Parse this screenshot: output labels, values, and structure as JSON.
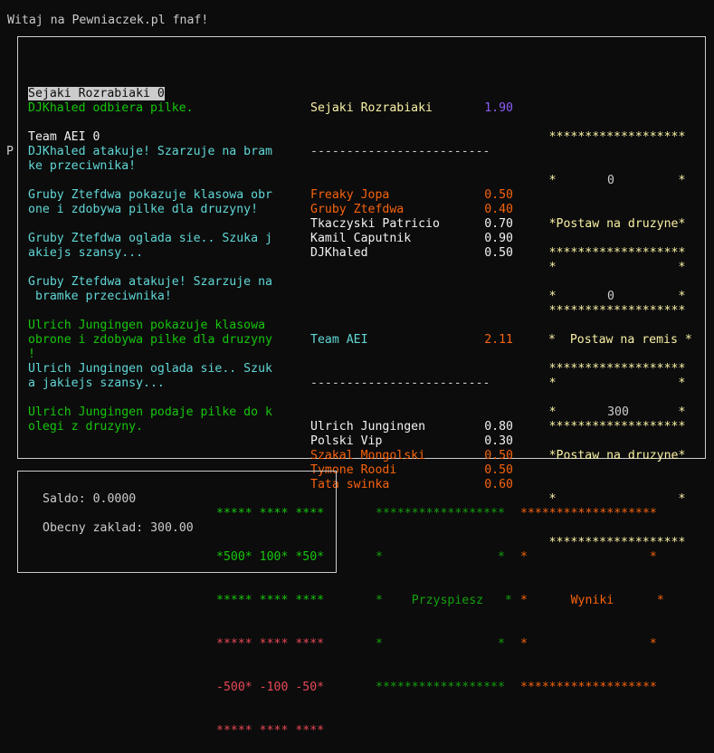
{
  "title": "Witaj na Pewniaczek.pl fnaf!",
  "left_marker": "P",
  "scoreboard": {
    "team1": "Sejaki Rozrabiaki 0",
    "team2": "Team AEI 0"
  },
  "log": [
    {
      "text": "DJKhaled odbiera pilke.",
      "color": "green"
    },
    {
      "text": "",
      "color": "cyan"
    },
    {
      "text": "",
      "color": "cyan"
    },
    {
      "text": "DJKhaled atakuje! Szarzuje na bram",
      "color": "cyan"
    },
    {
      "text": "ke przeciwnika!",
      "color": "cyan"
    },
    {
      "text": "",
      "color": "cyan"
    },
    {
      "text": "Gruby Ztefdwa pokazuje klasowa obr",
      "color": "cyan"
    },
    {
      "text": "one i zdobywa pilke dla druzyny!",
      "color": "cyan"
    },
    {
      "text": "",
      "color": "cyan"
    },
    {
      "text": "Gruby Ztefdwa oglada sie.. Szuka j",
      "color": "cyan"
    },
    {
      "text": "akiejs szansy...",
      "color": "cyan"
    },
    {
      "text": "",
      "color": "cyan"
    },
    {
      "text": "Gruby Ztefdwa atakuje! Szarzuje na",
      "color": "cyan"
    },
    {
      "text": " bramke przeciwnika!",
      "color": "cyan"
    },
    {
      "text": "",
      "color": "cyan"
    },
    {
      "text": "Ulrich Jungingen pokazuje klasowa",
      "color": "green"
    },
    {
      "text": "obrone i zdobywa pilke dla druzyny",
      "color": "green"
    },
    {
      "text": "!",
      "color": "green"
    },
    {
      "text": "Ulrich Jungingen oglada sie.. Szuk",
      "color": "cyan"
    },
    {
      "text": "a jakiejs szansy...",
      "color": "cyan"
    },
    {
      "text": "",
      "color": "cyan"
    },
    {
      "text": "Ulrich Jungingen podaje pilke do k",
      "color": "green"
    },
    {
      "text": "olegi z druzyny.",
      "color": "green"
    }
  ],
  "teamA": {
    "name": "Sejaki Rozrabiaki",
    "odds": "1.90",
    "divider": "-------------------------",
    "players": [
      {
        "name": "Freaky Jopa",
        "rating": "0.50",
        "color": "orange"
      },
      {
        "name": "Gruby Ztefdwa",
        "rating": "0.40",
        "color": "orange"
      },
      {
        "name": "Tkaczyski Patricio",
        "rating": "0.70",
        "color": "white"
      },
      {
        "name": "Kamil Caputnik",
        "rating": "0.90",
        "color": "white"
      },
      {
        "name": "DJKhaled",
        "rating": "0.50",
        "color": "white"
      }
    ]
  },
  "teamB": {
    "name": "Team AEI",
    "odds": "2.11",
    "divider": "-------------------------",
    "players": [
      {
        "name": "Ulrich Jungingen",
        "rating": "0.80",
        "color": "white"
      },
      {
        "name": "Polski Vip",
        "rating": "0.30",
        "color": "white"
      },
      {
        "name": "Szakal Mongolski",
        "rating": "0.50",
        "color": "orange"
      },
      {
        "name": "Tymone Roodi",
        "rating": "0.50",
        "color": "orange"
      },
      {
        "name": "Tata swinka",
        "rating": "0.60",
        "color": "orange"
      }
    ]
  },
  "bets": {
    "border": "*******************",
    "side": "*                 *",
    "team1": {
      "label": "*Postaw na druzyne*",
      "amount": "0"
    },
    "draw": {
      "label": "*  Postaw na remis *",
      "amount": "0"
    },
    "team2": {
      "label": "*Postaw na druzyne*",
      "amount": "300"
    }
  },
  "wallet": {
    "saldo_label": "Saldo: 0.0000",
    "stake_label": "Obecny zaklad: 300.00",
    "plus_border": "***** **** ****",
    "plus_values": "*500* 100* *50*",
    "minus_border": "***** **** ****",
    "minus_values": "-500* -100 -50*"
  },
  "buttons": {
    "speed": {
      "border": "******************",
      "side": "*                *",
      "label": "*    Przyspiesz   *"
    },
    "results": {
      "border": "*******************",
      "side": "*                 *",
      "label": "*      Wyniki      *"
    }
  },
  "colors": {
    "background": "#0c0c0c",
    "cyan": "#61d6d6",
    "green": "#16c60c",
    "orange": "#f7630c",
    "yellow": "#f9f1a5",
    "red": "#e74856",
    "purple": "#8a5cf5"
  }
}
